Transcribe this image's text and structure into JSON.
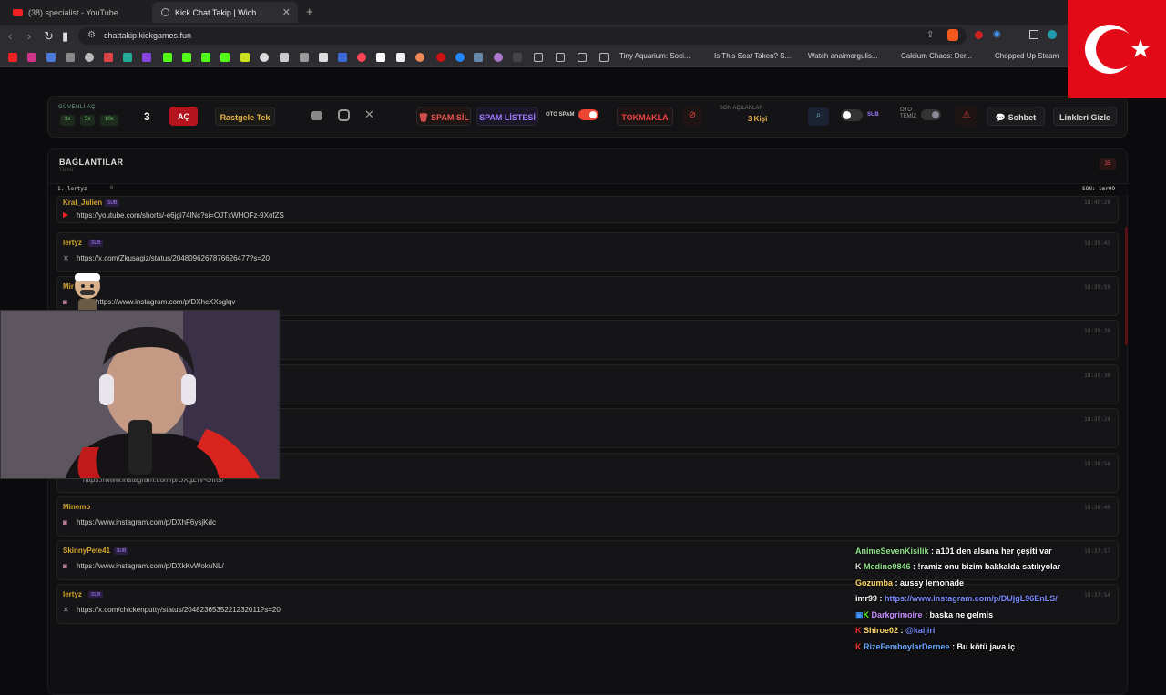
{
  "browser": {
    "tabs": [
      {
        "title": "(38) specialist - YouTube"
      },
      {
        "title": "Kick Chat Takip | Wich"
      }
    ],
    "url": "chattakip.kickgames.fun",
    "bookmarks": [
      "Tiny Aquarium: Soci...",
      "Is This Seat Taken? S...",
      "Watch analmorgulis...",
      "Calcium Chaos: Der...",
      "Chopped Up Steam"
    ]
  },
  "toolbar": {
    "safe_open_label": "GÜVENLİ AÇ",
    "multipliers": [
      "3x",
      "5x",
      "10x"
    ],
    "count": "3",
    "open_label": "AÇ",
    "random_label": "Rastgele Tek",
    "spam_delete_label": "SPAM SİL",
    "spam_list_label": "SPAM LİSTESİ",
    "auto_spam_label": "OTO SPAM",
    "tokmakla_label": "TOKMAKLA",
    "last_opened_label": "SON AÇILANLAR",
    "last_opened_value": "3 Kişi",
    "sub_label": "SUB",
    "auto_clean_label": "OTO TEMİZ",
    "chat_label": "Sohbet",
    "hide_links_label": "Linkleri Gizle"
  },
  "panel": {
    "title": "BAĞLANTILAR",
    "subtitle": "Tümü",
    "count": "35",
    "top_rank": "1. lertyz",
    "top_rank_count": "6",
    "last_label": "SON: imr99"
  },
  "messages": [
    {
      "user": "Kral_Julien",
      "sub": "SUB",
      "link": "https://youtube.com/shorts/-e6jgi74lNc?si=OJTxWHOFz-9XofZS",
      "time": "18:40:28",
      "icon": "youtube-icon"
    },
    {
      "user": "lertyz",
      "sub": "SUB",
      "link": "https://x.com/Zkusagiz/status/2048096267876626477?s=20",
      "time": "18:39:43",
      "icon": "x-icon"
    },
    {
      "user": "Mir",
      "sub": "",
      "link": "https://www.instagram.com/p/DXhcXXsglqv",
      "time": "18:39:59",
      "icon": "instagram-icon"
    },
    {
      "user": "",
      "sub": "",
      "link": "",
      "time": "18:39:39",
      "icon": ""
    },
    {
      "user": "",
      "sub": "",
      "link": "",
      "time": "18:39:30",
      "icon": ""
    },
    {
      "user": "",
      "sub": "",
      "link": "",
      "time": "18:39:24",
      "icon": ""
    },
    {
      "user": "",
      "sub": "",
      "link": "https://www.instagram.com/p/DXgZW-GIrts/",
      "time": "18:38:56",
      "icon": "instagram-icon"
    },
    {
      "user": "Minemo",
      "sub": "",
      "link": "https://www.instagram.com/p/DXhF6ysjKdc",
      "time": "18:38:49",
      "icon": "instagram-icon"
    },
    {
      "user": "SkinnyPete41",
      "sub": "SUB",
      "link": "https://www.instagram.com/p/DXkKvWokuNL/",
      "time": "18:37:57",
      "icon": "instagram-icon"
    },
    {
      "user": "lertyz",
      "sub": "SUB",
      "link": "https://x.com/chickenputty/status/2048236535221232011?s=20",
      "time": "18:37:54",
      "icon": "x-icon"
    }
  ],
  "chat": [
    {
      "user": "AnimeSevenKisilik",
      "text": " : a101 den alsana her çeşiti var",
      "color": "#8fe388"
    },
    {
      "user": "Medino9846",
      "text": " : !ramiz onu bizim bakkalda satılıyolar",
      "color": "#8fe388"
    },
    {
      "user": "Gozumba",
      "text": " : aussy lemonade",
      "color": "#ffd966"
    },
    {
      "user": "imr99",
      "text": " : ",
      "link": "https://www.instagram.com/p/DUjgL96EnLS/",
      "color": "#ffffff"
    },
    {
      "user": "Darkgrimoire",
      "text": " : baska ne gelmis",
      "color": "#c88cff"
    },
    {
      "user": "Shiroe02",
      "text": " : ",
      "link": "@kaijiri",
      "color": "#ffd966"
    },
    {
      "user": "RizeFemboylarDernee",
      "text": " : Bu kötü java iç",
      "color": "#6aa7ff"
    }
  ]
}
